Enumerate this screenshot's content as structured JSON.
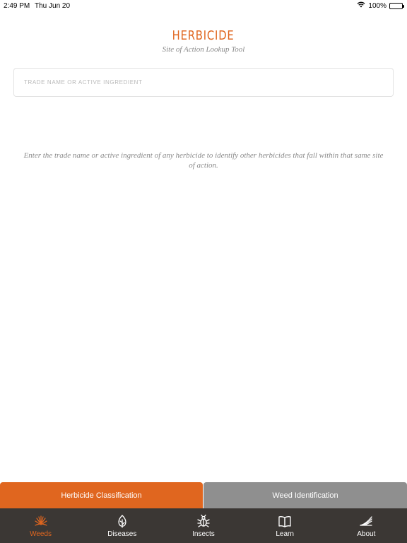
{
  "status_bar": {
    "time": "2:49 PM",
    "date": "Thu Jun 20",
    "battery": "100%"
  },
  "header": {
    "title": "HERBICIDE",
    "subtitle": "Site of Action Lookup Tool"
  },
  "search": {
    "placeholder": "TRADE NAME OR ACTIVE INGREDIENT",
    "value": ""
  },
  "hint": "Enter the trade name or active ingredient of any herbicide to identify other herbicides that fall within that same site of action.",
  "segments": [
    {
      "label": "Herbicide Classification",
      "active": true
    },
    {
      "label": "Weed Identification",
      "active": false
    }
  ],
  "tabs": [
    {
      "label": "Weeds",
      "icon": "weeds-icon",
      "active": true
    },
    {
      "label": "Diseases",
      "icon": "diseases-icon",
      "active": false
    },
    {
      "label": "Insects",
      "icon": "insects-icon",
      "active": false
    },
    {
      "label": "Learn",
      "icon": "book-icon",
      "active": false
    },
    {
      "label": "About",
      "icon": "about-icon",
      "active": false
    }
  ],
  "colors": {
    "accent": "#e0661f",
    "inactive_segment": "#8f8f8f",
    "tab_bar": "#3b3734"
  }
}
